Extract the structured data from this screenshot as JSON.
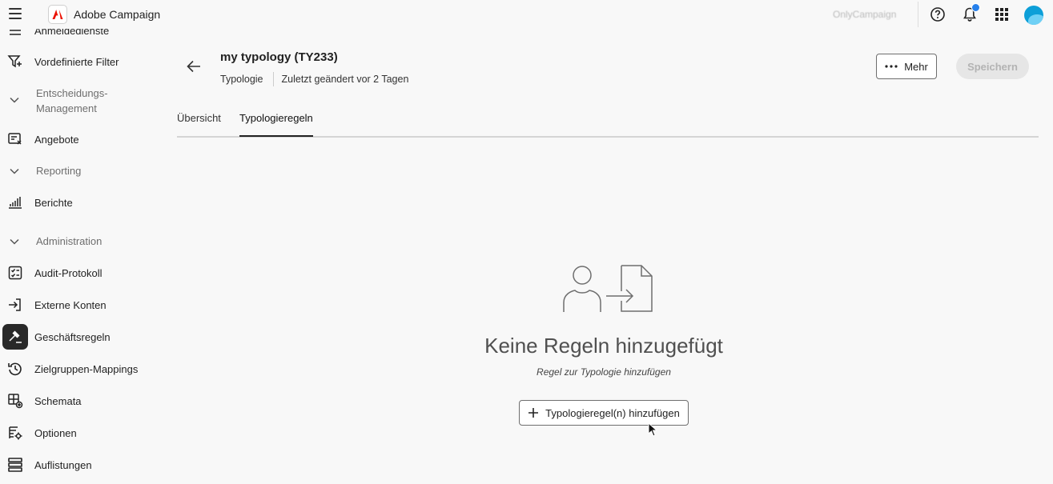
{
  "app": {
    "name": "Adobe Campaign",
    "org": "OnlyCampaign",
    "accent_color": "#2680eb",
    "brand_color": "#eb1000"
  },
  "sidebar": {
    "items": [
      {
        "label": "Anmeldedienste",
        "icon": "list-icon"
      },
      {
        "label": "Vordefinierte Filter",
        "icon": "filter-icon"
      },
      {
        "label": "Angebote",
        "icon": "offer-icon"
      },
      {
        "label": "Berichte",
        "icon": "chart-icon"
      },
      {
        "label": "Audit-Protokoll",
        "icon": "checklist-icon"
      },
      {
        "label": "Externe Konten",
        "icon": "login-icon"
      },
      {
        "label": "Geschäftsregeln",
        "icon": "gavel-icon"
      },
      {
        "label": "Zielgruppen-Mappings",
        "icon": "history-icon"
      },
      {
        "label": "Schemata",
        "icon": "schema-icon"
      },
      {
        "label": "Optionen",
        "icon": "options-icon"
      },
      {
        "label": "Auflistungen",
        "icon": "enumeration-icon"
      }
    ],
    "groups": [
      {
        "label": "Entscheidungs-\nManagement"
      },
      {
        "label": "Reporting"
      },
      {
        "label": "Administration"
      }
    ]
  },
  "header": {
    "title": "my typology (TY233)",
    "type": "Typologie",
    "modified": "Zuletzt geändert vor 2 Tagen",
    "more_label": "Mehr",
    "save_label": "Speichern"
  },
  "tabs": [
    {
      "label": "Übersicht"
    },
    {
      "label": "Typologieregeln"
    }
  ],
  "empty_state": {
    "title": "Keine Regeln hinzugefügt",
    "subtitle": "Regel zur Typologie hinzufügen",
    "button_label": "Typologieregel(n) hinzufügen"
  }
}
